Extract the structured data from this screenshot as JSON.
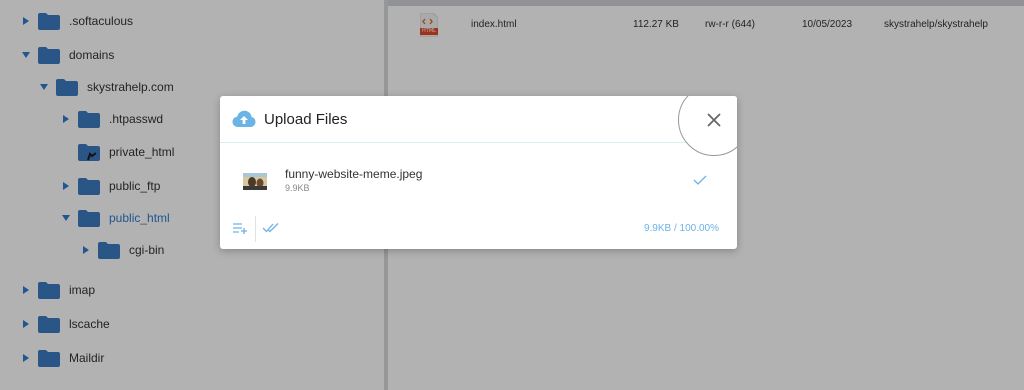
{
  "file_tree": {
    "items": [
      {
        "label": ".softaculous",
        "expanded": false,
        "has_children": true,
        "level": 0
      },
      {
        "label": "domains",
        "expanded": true,
        "has_children": true,
        "level": 0
      },
      {
        "label": "skystrahelp.com",
        "expanded": true,
        "has_children": true,
        "level": 1
      },
      {
        "label": ".htpasswd",
        "expanded": false,
        "has_children": true,
        "level": 2
      },
      {
        "label": "private_html",
        "expanded": false,
        "has_children": false,
        "level": 2,
        "is_link": true
      },
      {
        "label": "public_ftp",
        "expanded": false,
        "has_children": true,
        "level": 2
      },
      {
        "label": "public_html",
        "expanded": true,
        "has_children": true,
        "level": 2,
        "active": true
      },
      {
        "label": "cgi-bin",
        "expanded": false,
        "has_children": true,
        "level": 3
      },
      {
        "label": "imap",
        "expanded": false,
        "has_children": true,
        "level": 0
      },
      {
        "label": "lscache",
        "expanded": false,
        "has_children": true,
        "level": 0
      },
      {
        "label": "Maildir",
        "expanded": false,
        "has_children": true,
        "level": 0
      }
    ]
  },
  "file_list": {
    "rows": [
      {
        "name": "index.html",
        "size": "112.27 KB",
        "permissions": "rw-r-r (644)",
        "date": "10/05/2023",
        "owner": "skystrahelp/skystrahelp",
        "icon": "html-file-icon",
        "icon_badge": "HTML"
      }
    ]
  },
  "upload_dialog": {
    "title": "Upload Files",
    "files": [
      {
        "name": "funny-website-meme.jpeg",
        "size": "9.9KB",
        "status": "complete"
      }
    ],
    "total": "9.9KB / 100.00%"
  },
  "colors": {
    "accent": "#2e7bd0",
    "folder": "#3d7cc2",
    "light_blue": "#6ab4e6",
    "overlay": "rgba(0,0,0,0.30)"
  }
}
